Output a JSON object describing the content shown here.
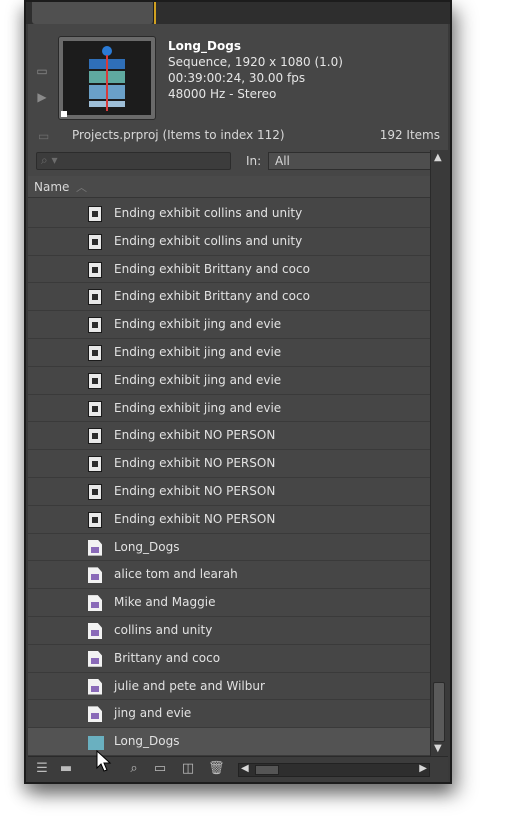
{
  "sequence": {
    "title": "Long_Dogs",
    "details": "Sequence, 1920 x 1080 (1.0)",
    "timing": "00:39:00:24, 30.00 fps",
    "audio": "48000 Hz - Stereo"
  },
  "project": {
    "name": "Projects.prproj (Items to index 112)",
    "count": "192 Items"
  },
  "search": {
    "in_label": "In:",
    "in_value": "All"
  },
  "columns": {
    "name": "Name"
  },
  "items": [
    {
      "label": "Ending exhibit collins and unity",
      "icon": "audio-clip-icon"
    },
    {
      "label": "Ending exhibit collins and unity",
      "icon": "audio-clip-icon"
    },
    {
      "label": "Ending exhibit Brittany and coco",
      "icon": "audio-clip-icon"
    },
    {
      "label": "Ending exhibit Brittany and coco",
      "icon": "audio-clip-icon"
    },
    {
      "label": "Ending exhibit jing and evie",
      "icon": "audio-clip-icon"
    },
    {
      "label": "Ending exhibit jing and evie",
      "icon": "audio-clip-icon"
    },
    {
      "label": "Ending exhibit jing and evie",
      "icon": "audio-clip-icon"
    },
    {
      "label": "Ending exhibit jing and evie",
      "icon": "audio-clip-icon"
    },
    {
      "label": "Ending exhibit NO PERSON",
      "icon": "audio-clip-icon"
    },
    {
      "label": "Ending exhibit NO PERSON",
      "icon": "audio-clip-icon"
    },
    {
      "label": "Ending exhibit NO PERSON",
      "icon": "audio-clip-icon"
    },
    {
      "label": "Ending exhibit NO PERSON",
      "icon": "audio-clip-icon"
    },
    {
      "label": "Long_Dogs",
      "icon": "sequence-file-icon"
    },
    {
      "label": "alice tom and learah",
      "icon": "sequence-file-icon"
    },
    {
      "label": "Mike and Maggie",
      "icon": "sequence-file-icon"
    },
    {
      "label": "collins and unity",
      "icon": "sequence-file-icon"
    },
    {
      "label": "Brittany and coco",
      "icon": "sequence-file-icon"
    },
    {
      "label": "julie and pete and Wilbur",
      "icon": "sequence-file-icon"
    },
    {
      "label": "jing and evie",
      "icon": "sequence-file-icon"
    },
    {
      "label": "Long_Dogs",
      "icon": "sequence-icon"
    }
  ]
}
